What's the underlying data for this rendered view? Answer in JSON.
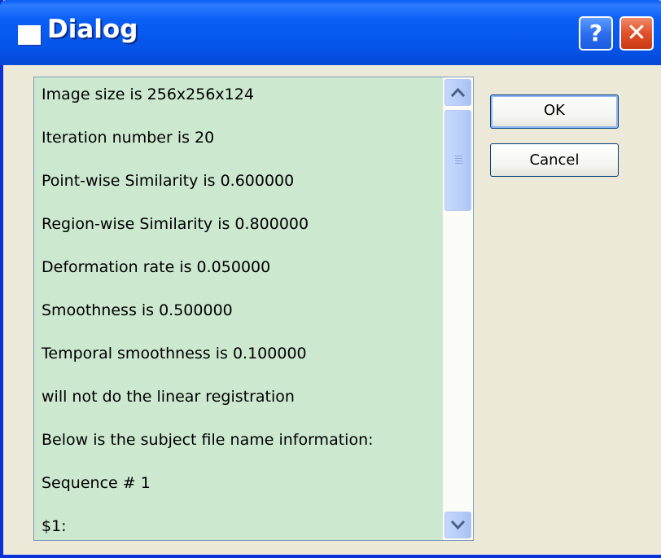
{
  "window": {
    "title": "Dialog"
  },
  "titlebar_buttons": {
    "help": "?",
    "close": "✕"
  },
  "listbox": {
    "lines": [
      "Image size is 256x256x124",
      "Iteration number is 20",
      "Point-wise Similarity is 0.600000",
      "Region-wise Similarity is 0.800000",
      "Deformation rate is 0.050000",
      "Smoothness is 0.500000",
      "Temporal smoothness is 0.100000",
      "will not do the linear registration",
      "Below is the subject file name information:",
      "Sequence # 1",
      "$1:"
    ]
  },
  "buttons": {
    "ok": "OK",
    "cancel": "Cancel"
  },
  "icons": {
    "window": "window-icon",
    "help": "help-icon",
    "close": "close-icon",
    "scroll_up": "chevron-up-icon",
    "scroll_down": "chevron-down-icon"
  },
  "colors": {
    "titlebar": "#0A5FF5",
    "list_background": "#CCE8CF",
    "dialog_background": "#ECE9D8",
    "close_button": "#E0502A"
  }
}
